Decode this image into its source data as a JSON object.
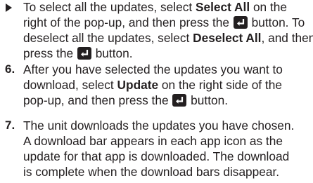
{
  "icons": {
    "bullet": "right-triangle-bullet",
    "enter_button": "enter-button-icon"
  },
  "bullet_item": {
    "l1_a": "To select all the updates, select ",
    "l1_b": "Select All",
    "l1_c": " on the",
    "l2_a": "right of the pop-up, and then press the ",
    "l2_c": " button. To",
    "l3_a": "deselect all the updates, select ",
    "l3_b": "Deselect All",
    "l3_c": ", and then",
    "l4_a": "press the ",
    "l4_c": " button."
  },
  "step6": {
    "number": "6.",
    "l1": "After you have selected the updates you want to",
    "l2_a": "download, select ",
    "l2_b": "Update",
    "l2_c": " on the right side of the",
    "l3_a": "pop-up, and then press the ",
    "l3_c": " button."
  },
  "step7": {
    "number": "7.",
    "l1": "The unit downloads the updates you have chosen.",
    "l2": "A download bar appears in each app icon as the",
    "l3": "update for that app is downloaded. The download",
    "l4": "is complete when the download bars disappear."
  }
}
